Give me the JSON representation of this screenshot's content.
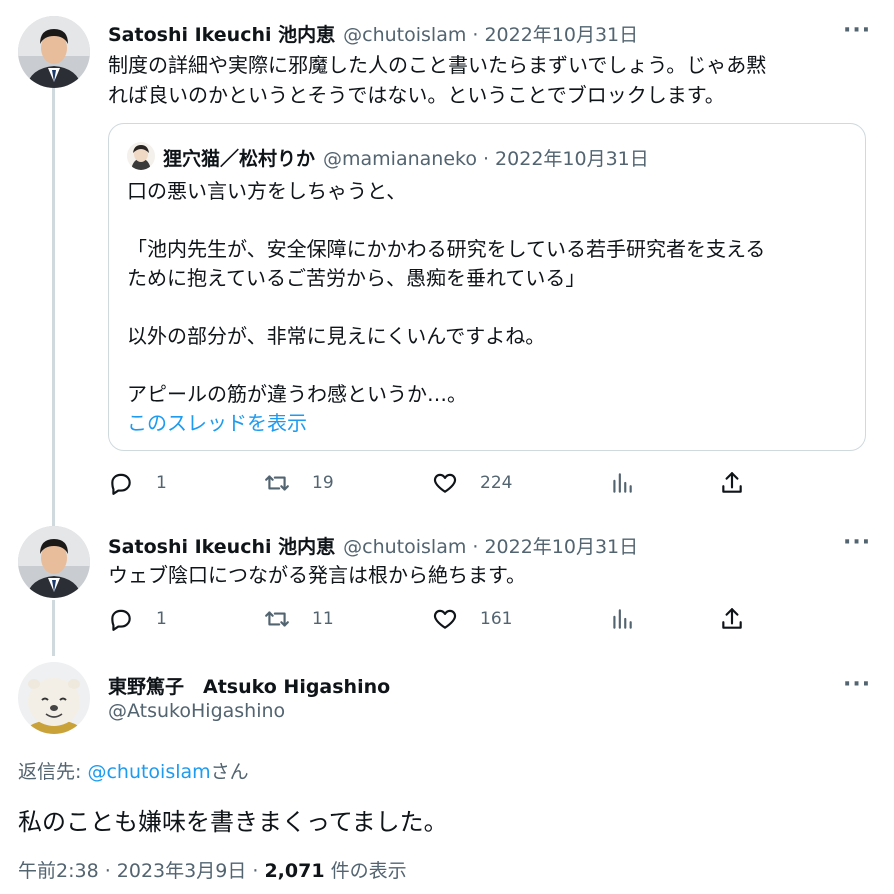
{
  "tweet1": {
    "author_name": "Satoshi Ikeuchi 池内恵",
    "author_handle": "@chutoislam",
    "date": "· 2022年10月31日",
    "text": "制度の詳細や実際に邪魔した人のこと書いたらまずいでしょう。じゃあ黙\nれば良いのかというとそうではない。ということでブロックします。",
    "quote": {
      "author_name": "狸穴猫／松村りか",
      "author_handle": "@mamiananeko",
      "date": "· 2022年10月31日",
      "text": "口の悪い言い方をしちゃうと、\n\n「池内先生が、安全保障にかかわる研究をしている若手研究者を支える\nために抱えているご苦労から、愚痴を垂れている」\n\n以外の部分が、非常に見えにくいんですよね。\n\nアピールの筋が違うわ感というか…。",
      "show_thread": "このスレッドを表示"
    },
    "replies": "1",
    "retweets": "19",
    "likes": "224"
  },
  "tweet2": {
    "author_name": "Satoshi Ikeuchi 池内恵",
    "author_handle": "@chutoislam",
    "date": "· 2022年10月31日",
    "text": "ウェブ陰口につながる発言は根から絶ちます。",
    "replies": "1",
    "retweets": "11",
    "likes": "161"
  },
  "main_tweet": {
    "author_name": "東野篤子　Atsuko Higashino",
    "author_handle": "@AtsukoHigashino",
    "reply_prefix": "返信先: ",
    "reply_to": "@chutoislam",
    "reply_suffix": "さん",
    "text": "私のことも嫌味を書きまくってました。",
    "time_date": "午前2:38 · 2023年3月9日 · ",
    "view_count": "2,071",
    "view_label": " 件の表示"
  },
  "more_symbol": "···",
  "icons": [
    "reply-icon",
    "retweet-icon",
    "like-icon",
    "analytics-icon",
    "share-icon",
    "more-icon"
  ],
  "colors": {
    "link": "#1d9bf0",
    "secondary_text": "#536471",
    "border": "#cfd9de"
  }
}
